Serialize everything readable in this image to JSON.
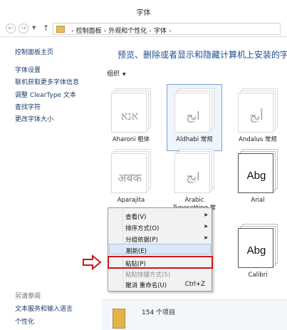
{
  "window": {
    "title": "字体"
  },
  "address": {
    "back_icon": "back-arrow-icon",
    "forward_icon": "forward-arrow-icon",
    "up_icon": "up-arrow-icon",
    "crumbs": [
      "控制面板",
      "外观和个性化",
      "字体"
    ]
  },
  "sidebar": {
    "home_link": "控制面板主页",
    "tasks": [
      "字体设置",
      "联机获取更多字体信息",
      "调整 ClearType 文本",
      "查找字符",
      "更改字体大小"
    ],
    "see_also_heading": "另请参阅",
    "see_also": [
      "文本服务和输入语言",
      "个性化"
    ]
  },
  "main": {
    "headline": "预览、删除或者显示和隐藏计算机上安装的字体",
    "organize_label": "组织"
  },
  "fonts": [
    {
      "name": "Aharoni 粗体",
      "sample": "אנא",
      "style": "light"
    },
    {
      "name": "Aldhabi 常规",
      "sample": "ابج",
      "style": "light",
      "selected": true
    },
    {
      "name": "Andalus 常规",
      "sample": "أبج",
      "style": "light"
    },
    {
      "name": "Aparajita",
      "sample": "अबक",
      "style": "light"
    },
    {
      "name": "Arabic Typesetting 常",
      "sample": "ابج",
      "style": "light"
    },
    {
      "name": "Arial",
      "sample": "Abg",
      "style": "dark"
    },
    {
      "name": "Calibri",
      "sample": "Abg",
      "style": "dark"
    }
  ],
  "context_menu": {
    "items": [
      {
        "label": "查看(V)",
        "submenu": true
      },
      {
        "label": "排序方式(O)",
        "submenu": true
      },
      {
        "label": "分组依据(P)",
        "submenu": true
      },
      {
        "label": "刷新(E)"
      },
      {
        "label": "粘贴(P)"
      },
      {
        "label": "粘贴快捷方式(S)",
        "disabled": true
      },
      {
        "label": "撤消 重命名(U)",
        "shortcut": "Ctrl+Z"
      }
    ]
  },
  "status": {
    "count_text": "154 个项目"
  },
  "colors": {
    "annotation": "#c81818",
    "link": "#1e3d6b",
    "headline": "#1e4f91"
  }
}
